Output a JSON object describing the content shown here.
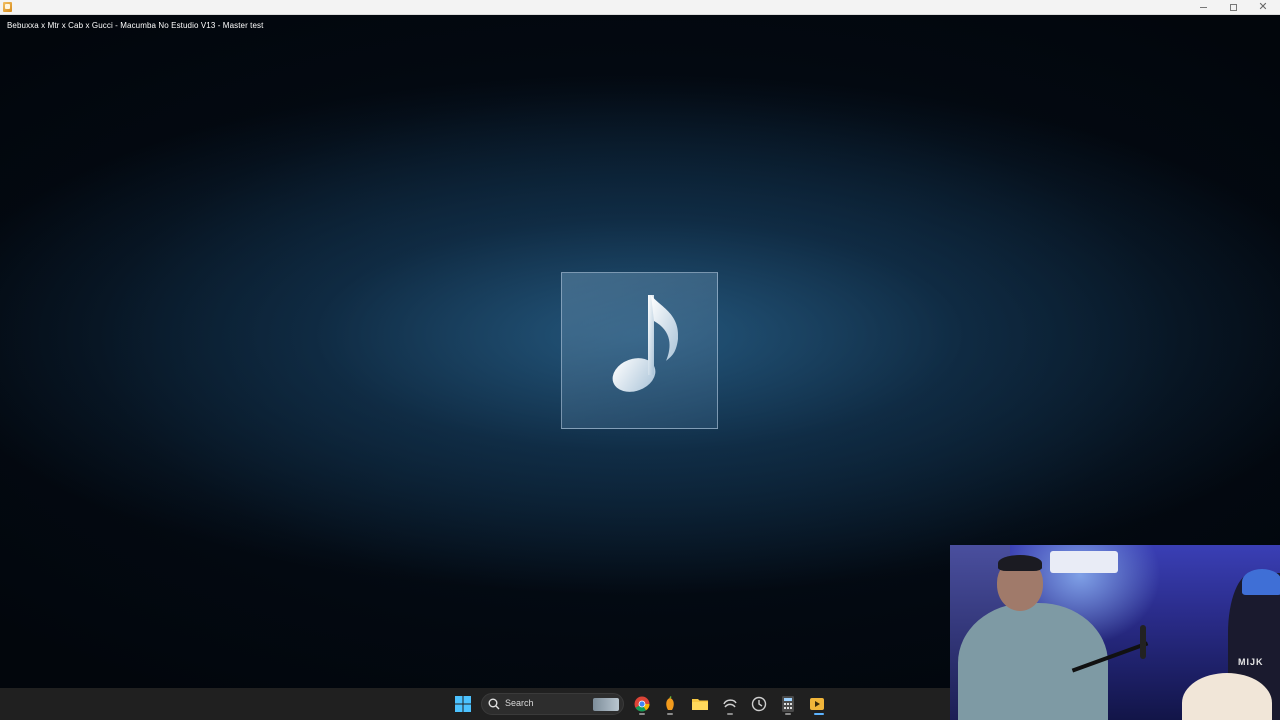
{
  "window": {
    "title": "",
    "controls": {
      "minimize": "minimize",
      "maximize": "restore",
      "close": "close"
    }
  },
  "player": {
    "media_title": "Bebuxxa x Mtr x Cab x Gucci - Macumba No Estudio V13  - Master test",
    "artwork_icon": "music-note-icon",
    "background_colors": [
      "#02060c",
      "#163c5c",
      "#285f87"
    ]
  },
  "webcam": {
    "sign_text": "MIJK"
  },
  "taskbar": {
    "search_label": "Search",
    "apps": [
      {
        "name": "start-button",
        "icon": "windows-logo-icon"
      },
      {
        "name": "chrome-app",
        "icon": "chrome-icon"
      },
      {
        "name": "fl-studio-app",
        "icon": "fruit-icon"
      },
      {
        "name": "file-explorer-app",
        "icon": "folder-icon"
      },
      {
        "name": "app-swirl",
        "icon": "swirl-icon"
      },
      {
        "name": "app-clock",
        "icon": "clock-icon"
      },
      {
        "name": "calculator-app",
        "icon": "calculator-icon"
      },
      {
        "name": "media-player-app",
        "icon": "media-player-icon"
      }
    ]
  }
}
